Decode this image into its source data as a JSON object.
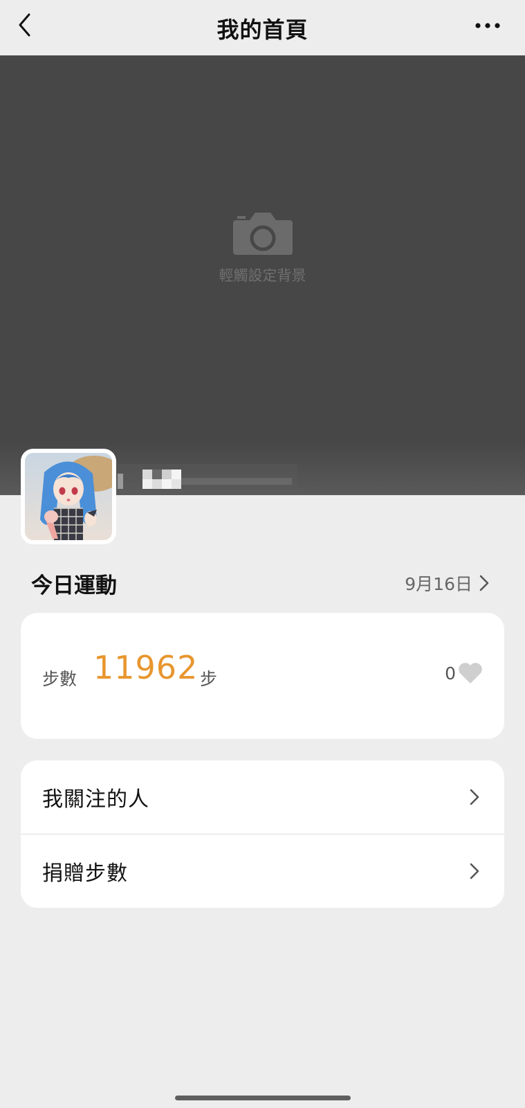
{
  "nav": {
    "title": "我的首頁",
    "back_icon": "chevron-left-icon",
    "more_icon": "more-dots-icon"
  },
  "cover": {
    "hint": "輕觸設定背景",
    "camera_icon": "camera-icon"
  },
  "profile": {
    "nickname_redacted": true
  },
  "today_exercise": {
    "title": "今日運動",
    "date": "9月16日"
  },
  "steps_card": {
    "label": "步數",
    "value": "11962",
    "unit": "步",
    "likes": "0",
    "accent_color": "#e8962e"
  },
  "menu": {
    "items": [
      {
        "label": "我關注的人"
      },
      {
        "label": "捐贈步數"
      }
    ]
  }
}
